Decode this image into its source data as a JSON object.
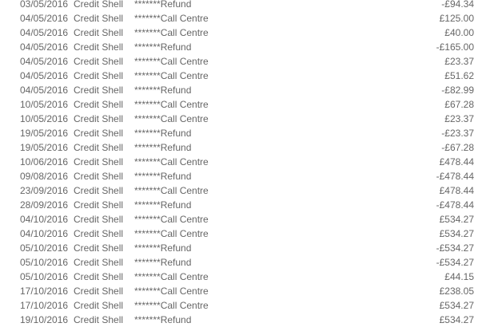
{
  "transactions": [
    {
      "date": "03/05/2016",
      "type": "Credit Shell",
      "description": "*******Refund",
      "amount": "-£94.34"
    },
    {
      "date": "04/05/2016",
      "type": "Credit Shell",
      "description": "*******Call Centre",
      "amount": "£125.00"
    },
    {
      "date": "04/05/2016",
      "type": "Credit Shell",
      "description": "*******Call Centre",
      "amount": "£40.00"
    },
    {
      "date": "04/05/2016",
      "type": "Credit Shell",
      "description": "*******Refund",
      "amount": "-£165.00"
    },
    {
      "date": "04/05/2016",
      "type": "Credit Shell",
      "description": "*******Call Centre",
      "amount": "£23.37"
    },
    {
      "date": "04/05/2016",
      "type": "Credit Shell",
      "description": "*******Call Centre",
      "amount": "£51.62"
    },
    {
      "date": "04/05/2016",
      "type": "Credit Shell",
      "description": "*******Refund",
      "amount": "-£82.99"
    },
    {
      "date": "10/05/2016",
      "type": "Credit Shell",
      "description": "*******Call Centre",
      "amount": "£67.28"
    },
    {
      "date": "10/05/2016",
      "type": "Credit Shell",
      "description": "*******Call Centre",
      "amount": "£23.37"
    },
    {
      "date": "19/05/2016",
      "type": "Credit Shell",
      "description": "*******Refund",
      "amount": "-£23.37"
    },
    {
      "date": "19/05/2016",
      "type": "Credit Shell",
      "description": "*******Refund",
      "amount": "-£67.28"
    },
    {
      "date": "10/06/2016",
      "type": "Credit Shell",
      "description": "*******Call Centre",
      "amount": "£478.44"
    },
    {
      "date": "09/08/2016",
      "type": "Credit Shell",
      "description": "*******Refund",
      "amount": "-£478.44"
    },
    {
      "date": "23/09/2016",
      "type": "Credit Shell",
      "description": "*******Call Centre",
      "amount": "£478.44"
    },
    {
      "date": "28/09/2016",
      "type": "Credit Shell",
      "description": "*******Refund",
      "amount": "-£478.44"
    },
    {
      "date": "04/10/2016",
      "type": "Credit Shell",
      "description": "*******Call Centre",
      "amount": "£534.27"
    },
    {
      "date": "04/10/2016",
      "type": "Credit Shell",
      "description": "*******Call Centre",
      "amount": "£534.27"
    },
    {
      "date": "05/10/2016",
      "type": "Credit Shell",
      "description": "*******Refund",
      "amount": "-£534.27"
    },
    {
      "date": "05/10/2016",
      "type": "Credit Shell",
      "description": "*******Refund",
      "amount": "-£534.27"
    },
    {
      "date": "05/10/2016",
      "type": "Credit Shell",
      "description": "*******Call Centre",
      "amount": "£44.15"
    },
    {
      "date": "17/10/2016",
      "type": "Credit Shell",
      "description": "*******Call Centre",
      "amount": "£238.05"
    },
    {
      "date": "17/10/2016",
      "type": "Credit Shell",
      "description": "*******Call Centre",
      "amount": "£534.27"
    },
    {
      "date": "19/10/2016",
      "type": "Credit Shell",
      "description": "*******Refund",
      "amount": "£534.27"
    }
  ],
  "colors": {
    "text": "#666666",
    "background": "#ffffff"
  }
}
